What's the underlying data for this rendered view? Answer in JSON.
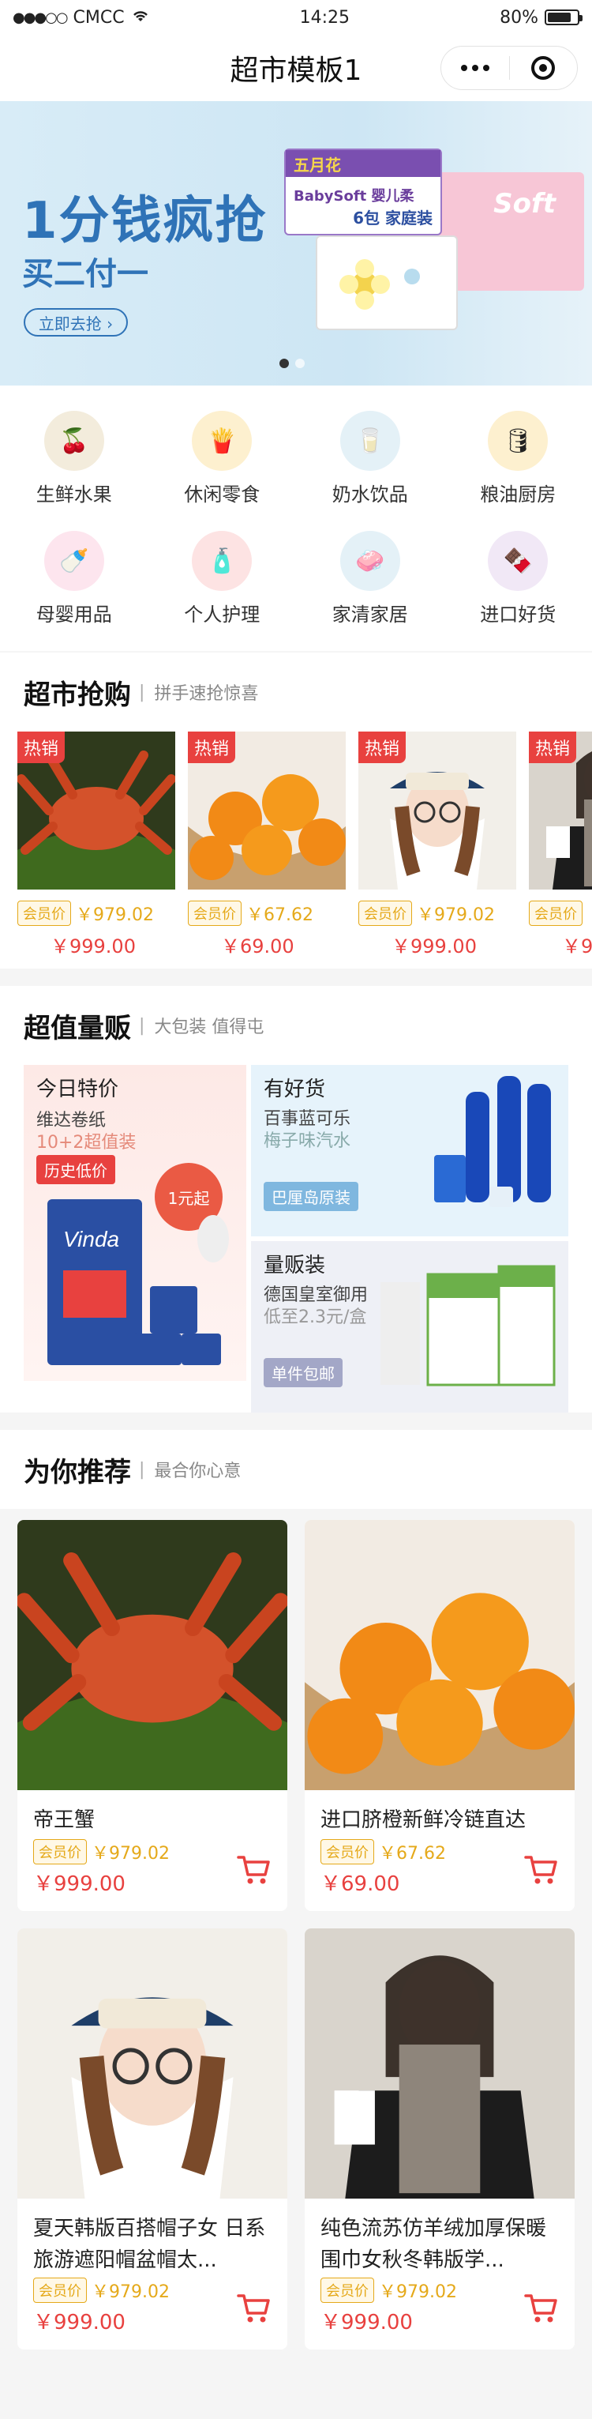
{
  "status": {
    "carrier": "CMCC",
    "time": "14:25",
    "battery": "80%",
    "battery_level": 0.8
  },
  "nav": {
    "title": "超市模板1"
  },
  "banner": {
    "line1": "1分钱疯抢",
    "line2": "买二付一",
    "button": "立即去抢 ›",
    "brand1": "五月花",
    "brand2": "BabySoft 婴儿柔",
    "brand3": "Soft",
    "pack": "6包 家庭装"
  },
  "categories": [
    {
      "label": "生鲜水果",
      "color": "#f3ecdc",
      "icon": "lychee-icon",
      "glyph": "🍒"
    },
    {
      "label": "休闲零食",
      "color": "#fdf0cf",
      "icon": "snack-icon",
      "glyph": "🍟"
    },
    {
      "label": "奶水饮品",
      "color": "#e4f1f7",
      "icon": "milk-icon",
      "glyph": "🥛"
    },
    {
      "label": "粮油厨房",
      "color": "#fdf0cf",
      "icon": "oil-icon",
      "glyph": "🛢"
    },
    {
      "label": "母婴用品",
      "color": "#fde5ee",
      "icon": "baby-icon",
      "glyph": "🍼"
    },
    {
      "label": "个人护理",
      "color": "#fde3e3",
      "icon": "care-icon",
      "glyph": "🧴"
    },
    {
      "label": "家清家居",
      "color": "#e4f1f7",
      "icon": "clean-icon",
      "glyph": "🧼"
    },
    {
      "label": "进口好货",
      "color": "#f1e8f6",
      "icon": "import-icon",
      "glyph": "🍫"
    }
  ],
  "flash": {
    "title": "超市抢购",
    "subtitle": "拼手速抢惊喜",
    "hot_label": "热销",
    "vip_label": "会员价",
    "items": [
      {
        "vip": "￥979.02",
        "price": "￥999.00"
      },
      {
        "vip": "￥67.62",
        "price": "￥69.00"
      },
      {
        "vip": "￥979.02",
        "price": "￥999.00"
      },
      {
        "vip": "",
        "price": "￥9"
      }
    ]
  },
  "value": {
    "title": "超值量贩",
    "subtitle": "大包装 值得屯",
    "left": {
      "title": "今日特价",
      "sub1": "维达卷纸",
      "sub2": "10+2超值装",
      "badge": "历史低价",
      "round": "1元起"
    },
    "top": {
      "title": "有好货",
      "sub1": "百事蓝可乐",
      "sub2": "梅子味汽水",
      "badge": "巴厘岛原装"
    },
    "bottom": {
      "title": "量贩装",
      "sub1": "德国皇室御用",
      "sub2": "低至2.3元/盒",
      "badge": "单件包邮"
    }
  },
  "recommend": {
    "title": "为你推荐",
    "subtitle": "最合你心意",
    "vip_label": "会员价",
    "items": [
      {
        "name": "帝王蟹",
        "vip": "￥979.02",
        "price": "￥999.00"
      },
      {
        "name": "进口脐橙新鲜冷链直达",
        "vip": "￥67.62",
        "price": "￥69.00"
      },
      {
        "name": "夏天韩版百搭帽子女 日系旅游遮阳帽盆帽太...",
        "vip": "￥979.02",
        "price": "￥999.00"
      },
      {
        "name": "纯色流苏仿羊绒加厚保暖围巾女秋冬韩版学...",
        "vip": "￥979.02",
        "price": "￥999.00"
      }
    ]
  }
}
